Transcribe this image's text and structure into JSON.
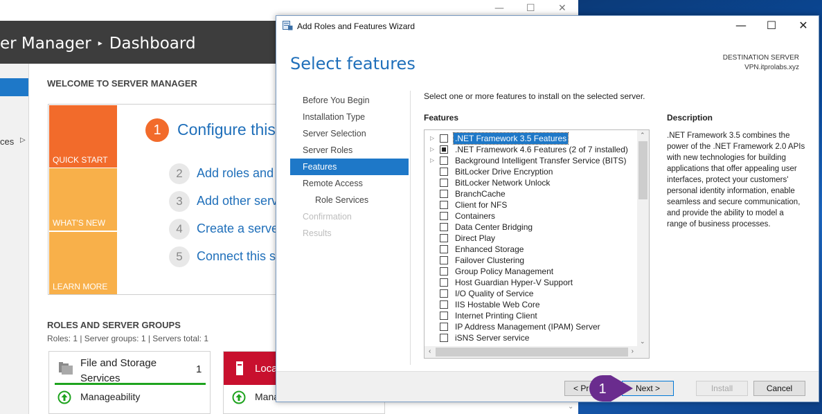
{
  "server_manager": {
    "window_controls": {
      "minimize": "—",
      "maximize": "☐",
      "close": "✕"
    },
    "header_app": "er Manager",
    "header_separator": "▸",
    "header_page": "Dashboard",
    "nav_services_label": "ces",
    "nav_services_arrow": "▷",
    "welcome_heading": "WELCOME TO SERVER MANAGER",
    "tiles": {
      "quick_start": "QUICK START",
      "whats_new": "WHAT'S NEW",
      "learn_more": "LEARN MORE"
    },
    "steps": [
      {
        "num": "1",
        "text": "Configure this"
      },
      {
        "num": "2",
        "text": "Add roles and"
      },
      {
        "num": "3",
        "text": "Add other serv"
      },
      {
        "num": "4",
        "text": "Create a serve"
      },
      {
        "num": "5",
        "text": "Connect this se"
      }
    ],
    "roles_heading": "ROLES AND SERVER GROUPS",
    "roles_summary": "Roles: 1   |   Server groups: 1   |   Servers total: 1",
    "cards": {
      "file_storage": {
        "title": "File and Storage Services",
        "count": "1",
        "manageability": "Manageability"
      },
      "local": {
        "title": "Loca",
        "manageability": "Mana"
      }
    }
  },
  "wizard": {
    "title": "Add Roles and Features Wizard",
    "controls": {
      "minimize": "—",
      "maximize": "☐",
      "close": "✕"
    },
    "heading": "Select features",
    "destination_label": "DESTINATION SERVER",
    "destination_value": "VPN.itprolabs.xyz",
    "nav_steps": [
      {
        "label": "Before You Begin",
        "state": "normal"
      },
      {
        "label": "Installation Type",
        "state": "normal"
      },
      {
        "label": "Server Selection",
        "state": "normal"
      },
      {
        "label": "Server Roles",
        "state": "normal"
      },
      {
        "label": "Features",
        "state": "active"
      },
      {
        "label": "Remote Access",
        "state": "normal"
      },
      {
        "label": "Role Services",
        "state": "sub"
      },
      {
        "label": "Confirmation",
        "state": "disabled"
      },
      {
        "label": "Results",
        "state": "disabled"
      }
    ],
    "instruction": "Select one or more features to install on the selected server.",
    "features_label": "Features",
    "features": [
      {
        "label": ".NET Framework 3.5 Features",
        "expandable": true,
        "state": "unchecked",
        "selected": true
      },
      {
        "label": ".NET Framework 4.6 Features (2 of 7 installed)",
        "expandable": true,
        "state": "partial",
        "selected": false
      },
      {
        "label": "Background Intelligent Transfer Service (BITS)",
        "expandable": true,
        "state": "unchecked",
        "selected": false
      },
      {
        "label": "BitLocker Drive Encryption",
        "expandable": false,
        "state": "unchecked",
        "selected": false
      },
      {
        "label": "BitLocker Network Unlock",
        "expandable": false,
        "state": "unchecked",
        "selected": false
      },
      {
        "label": "BranchCache",
        "expandable": false,
        "state": "unchecked",
        "selected": false
      },
      {
        "label": "Client for NFS",
        "expandable": false,
        "state": "unchecked",
        "selected": false
      },
      {
        "label": "Containers",
        "expandable": false,
        "state": "unchecked",
        "selected": false
      },
      {
        "label": "Data Center Bridging",
        "expandable": false,
        "state": "unchecked",
        "selected": false
      },
      {
        "label": "Direct Play",
        "expandable": false,
        "state": "unchecked",
        "selected": false
      },
      {
        "label": "Enhanced Storage",
        "expandable": false,
        "state": "unchecked",
        "selected": false
      },
      {
        "label": "Failover Clustering",
        "expandable": false,
        "state": "unchecked",
        "selected": false
      },
      {
        "label": "Group Policy Management",
        "expandable": false,
        "state": "unchecked",
        "selected": false
      },
      {
        "label": "Host Guardian Hyper-V Support",
        "expandable": false,
        "state": "unchecked",
        "selected": false
      },
      {
        "label": "I/O Quality of Service",
        "expandable": false,
        "state": "unchecked",
        "selected": false
      },
      {
        "label": "IIS Hostable Web Core",
        "expandable": false,
        "state": "unchecked",
        "selected": false
      },
      {
        "label": "Internet Printing Client",
        "expandable": false,
        "state": "unchecked",
        "selected": false
      },
      {
        "label": "IP Address Management (IPAM) Server",
        "expandable": false,
        "state": "unchecked",
        "selected": false
      },
      {
        "label": "iSNS Server service",
        "expandable": false,
        "state": "unchecked",
        "selected": false
      }
    ],
    "description_label": "Description",
    "description_text": ".NET Framework 3.5 combines the power of the .NET Framework 2.0 APIs with new technologies for building applications that offer appealing user interfaces, protect your customers' personal identity information, enable seamless and secure communication, and provide the ability to model a range of business processes.",
    "buttons": {
      "previous": "< Pr",
      "next": "Next >",
      "install": "Install",
      "cancel": "Cancel"
    }
  },
  "callout": {
    "number": "1",
    "color": "#6a2c8e"
  },
  "colors": {
    "accent": "#1e78c8",
    "header_dark": "#3d3d3d",
    "quick_start": "#f26b2b",
    "tile_light": "#f8b04a",
    "status_red": "#c8102e",
    "status_green": "#1ea31e"
  }
}
